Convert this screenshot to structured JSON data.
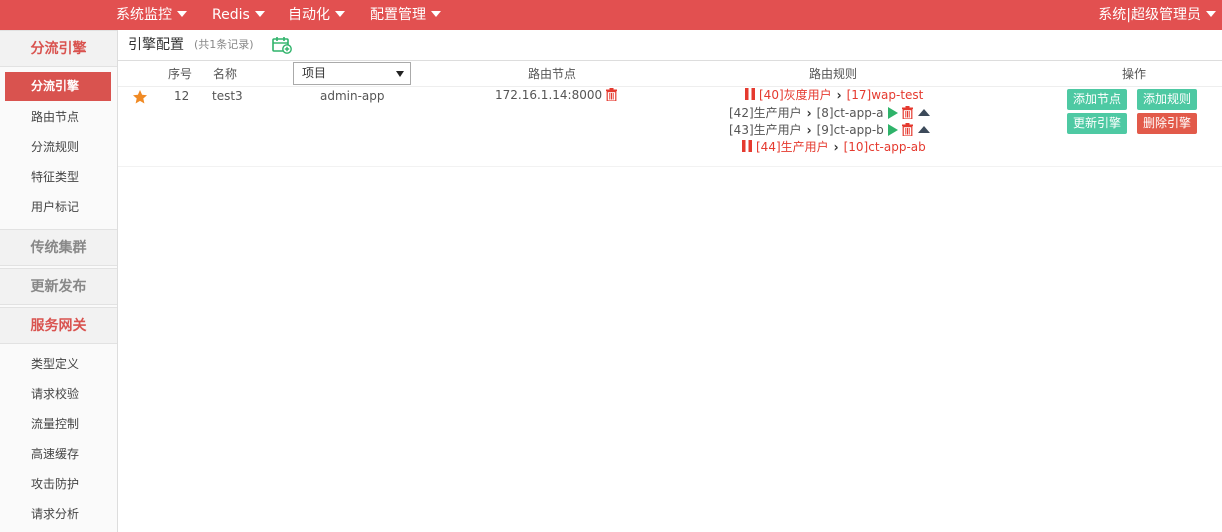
{
  "topnav": {
    "items": [
      "系统监控",
      "Redis",
      "自动化",
      "配置管理"
    ],
    "user": "系统|超级管理员"
  },
  "sidebar": {
    "section1": "分流引擎",
    "section1_items": [
      "分流引擎",
      "路由节点",
      "分流规则",
      "特征类型",
      "用户标记"
    ],
    "section2": "传统集群",
    "section3": "更新发布",
    "section4": "服务网关",
    "section4_items": [
      "类型定义",
      "请求校验",
      "流量控制",
      "高速缓存",
      "攻击防护",
      "请求分析"
    ]
  },
  "main": {
    "title": "引擎配置",
    "count": "(共1条记录)",
    "headers": {
      "seq": "序号",
      "name": "名称",
      "project_select": "项目",
      "node": "路由节点",
      "rules": "路由规则",
      "ops": "操作"
    },
    "row": {
      "seq": "12",
      "name": "test3",
      "project": "admin-app",
      "node": "172.16.1.14:8000",
      "rules": [
        {
          "user": "[40]灰度用户",
          "target": "[17]wap-test"
        },
        {
          "user": "[42]生产用户",
          "target": "[8]ct-app-a"
        },
        {
          "user": "[43]生产用户",
          "target": "[9]ct-app-b"
        },
        {
          "user": "[44]生产用户",
          "target": "[10]ct-app-ab"
        }
      ],
      "buttons": {
        "add_node": "添加节点",
        "add_rule": "添加规则",
        "update_engine": "更新引擎",
        "delete_engine": "删除引擎"
      }
    }
  },
  "colors": {
    "brand": "#e25050",
    "accent_green": "#4ec9a3",
    "danger": "#e25a4a"
  }
}
